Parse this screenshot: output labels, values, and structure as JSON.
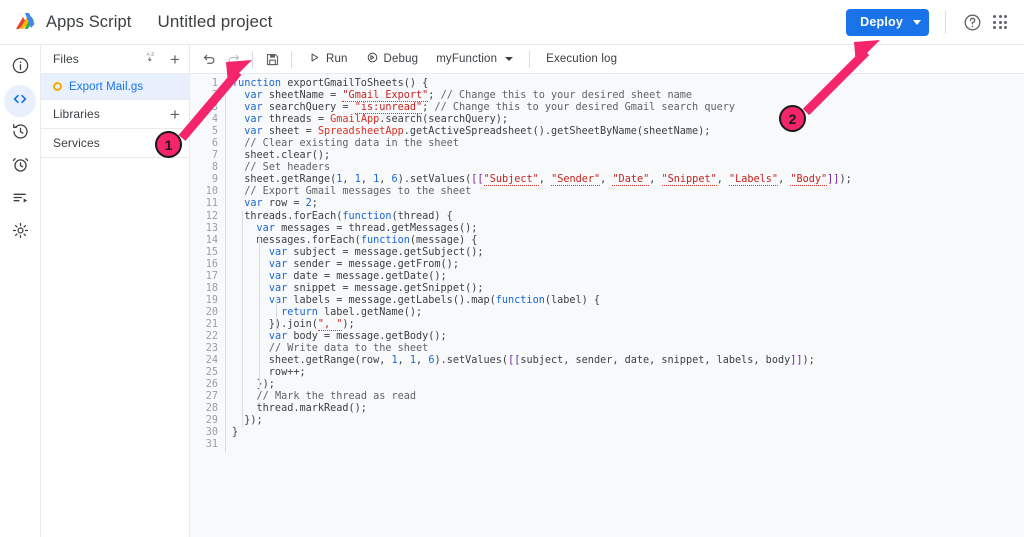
{
  "topbar": {
    "logo_icon": "apps-script-logo",
    "brand": "Apps Script",
    "project_title": "Untitled project",
    "deploy_label": "Deploy",
    "deploy_color": "#1a73e8",
    "help_icon": "help-circle-icon",
    "apps_icon": "google-apps-grid-icon"
  },
  "rail": {
    "items": [
      {
        "icon": "info-icon",
        "name": "overview",
        "active": false
      },
      {
        "icon": "code-icon",
        "name": "editor",
        "active": true
      },
      {
        "icon": "history-clock-icon",
        "name": "project-history",
        "active": false
      },
      {
        "icon": "alarm-clock-icon",
        "name": "triggers",
        "active": false
      },
      {
        "icon": "executions-list-icon",
        "name": "executions",
        "active": false
      },
      {
        "icon": "gear-icon",
        "name": "project-settings",
        "active": false
      }
    ]
  },
  "files_panel": {
    "files_header": "Files",
    "sort_icon": "sort-az-icon",
    "add_icon": "plus-icon",
    "file": {
      "name": "Export Mail.gs",
      "status_icon": "gs-file-dot-icon",
      "status_color": "#f9ab00",
      "selected": true
    },
    "libraries_header": "Libraries",
    "services_header": "Services"
  },
  "editor_toolbar": {
    "undo_icon": "undo-icon",
    "redo_icon": "redo-icon",
    "save_icon": "save-disk-icon",
    "run_label": "Run",
    "run_icon": "play-triangle-icon",
    "debug_label": "Debug",
    "debug_icon": "debug-bug-icon",
    "function_selector": "myFunction",
    "function_caret": "chevron-down-icon",
    "execution_log_label": "Execution log"
  },
  "code": {
    "language": "javascript",
    "first_line": 1,
    "last_line": 31,
    "lines": [
      "function exportGmailToSheets() {",
      "  var sheetName = \"Gmail Export\"; // Change this to your desired sheet name",
      "  var searchQuery = \"is:unread\"; // Change this to your desired Gmail search query",
      "  var threads = GmailApp.search(searchQuery);",
      "  var sheet = SpreadsheetApp.getActiveSpreadsheet().getSheetByName(sheetName);",
      "  // Clear existing data in the sheet",
      "  sheet.clear();",
      "  // Set headers",
      "  sheet.getRange(1, 1, 1, 6).setValues([[\"Subject\", \"Sender\", \"Date\", \"Snippet\", \"Labels\", \"Body\"]]);",
      "  // Export Gmail messages to the sheet",
      "  var row = 2;",
      "  threads.forEach(function(thread) {",
      "    var messages = thread.getMessages();",
      "    messages.forEach(function(message) {",
      "      var subject = message.getSubject();",
      "      var sender = message.getFrom();",
      "      var date = message.getDate();",
      "      var snippet = message.getSnippet();",
      "      var labels = message.getLabels().map(function(label) {",
      "        return label.getName();",
      "      }).join(\", \");",
      "      var body = message.getBody();",
      "      // Write data to the sheet",
      "      sheet.getRange(row, 1, 1, 6).setValues([[subject, sender, date, snippet, labels, body]]);",
      "      row++;",
      "    });",
      "    // Mark the thread as read",
      "    thread.markRead();",
      "  });",
      "}",
      ""
    ]
  },
  "annotations": {
    "color": "#f5256b",
    "markers": [
      {
        "number": "1",
        "target": "save-disk-icon"
      },
      {
        "number": "2",
        "target": "deploy-button"
      }
    ]
  }
}
